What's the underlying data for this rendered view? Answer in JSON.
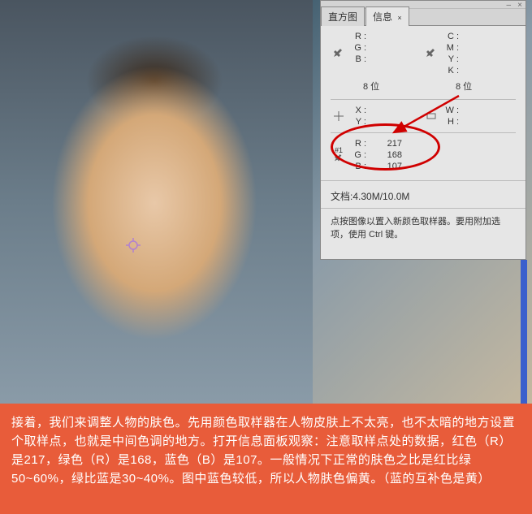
{
  "tabs": {
    "histogram": "直方图",
    "info": "信息"
  },
  "rgb": {
    "r_label": "R :",
    "g_label": "G :",
    "b_label": "B :",
    "r_value": "",
    "g_value": "",
    "b_value": ""
  },
  "cmyk": {
    "c_label": "C :",
    "m_label": "M :",
    "y_label": "Y :",
    "k_label": "K :"
  },
  "bits": {
    "left": "8 位",
    "right": "8 位"
  },
  "xy": {
    "x_label": "X :",
    "y_label": "Y :"
  },
  "wh": {
    "w_label": "W :",
    "h_label": "H :"
  },
  "sampler": {
    "index": "#1",
    "r_label": "R :",
    "g_label": "G :",
    "b_label": "B :",
    "r_value": "217",
    "g_value": "168",
    "b_value": "107"
  },
  "doc": {
    "label": "文档:",
    "value": "4.30M/10.0M"
  },
  "hint": "点按图像以置入新颜色取样器。要用附加选项，使用 Ctrl 键。",
  "caption": "接着，我们来调整人物的肤色。先用颜色取样器在人物皮肤上不太亮，也不太暗的地方设置个取样点，也就是中间色调的地方。打开信息面板观察：注意取样点处的数据，红色（R）是217，绿色（R）是168，蓝色（B）是107。一般情况下正常的肤色之比是红比绿50~60%，绿比蓝是30~40%。图中蓝色较低，所以人物肤色偏黄。（蓝的互补色是黄）",
  "icons": {
    "eyedropper": "eyedropper-icon",
    "crosshair": "crosshair-icon",
    "dimension": "dimension-icon",
    "sampler": "sampler-icon"
  }
}
